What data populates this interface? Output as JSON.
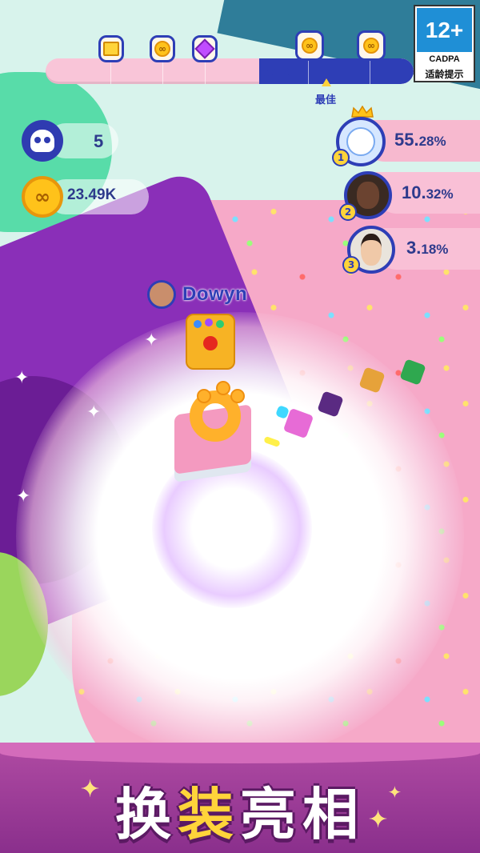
{
  "hud": {
    "progress": {
      "percent": 55,
      "label": "55%",
      "best_label": "最佳"
    },
    "milestones": [
      {
        "icon": "gift-box-icon"
      },
      {
        "icon": "coin-icon"
      },
      {
        "icon": "purple-gem-icon"
      },
      {
        "icon": "coin-icon"
      },
      {
        "icon": "coin-icon"
      }
    ],
    "kills": "5",
    "coins": "23.49K"
  },
  "age_rating": {
    "age": "12+",
    "org": "CADPA",
    "note": "适龄提示"
  },
  "leaderboard": [
    {
      "rank": "1",
      "percent_main": "55.",
      "percent_small": "28%",
      "avatar": "bunny-avatar"
    },
    {
      "rank": "2",
      "percent_main": "10.",
      "percent_small": "32%",
      "avatar": "man-avatar"
    },
    {
      "rank": "3",
      "percent_main": "3.",
      "percent_small": "18%",
      "avatar": "woman-avatar"
    }
  ],
  "player": {
    "name": "Dowyn"
  },
  "banner": {
    "title_part1": "换",
    "title_part2": "装",
    "title_part3": "亮相"
  },
  "colors": {
    "accent": "#2e3eb6",
    "coin": "#ffc21a",
    "banner": "#a0409a"
  }
}
